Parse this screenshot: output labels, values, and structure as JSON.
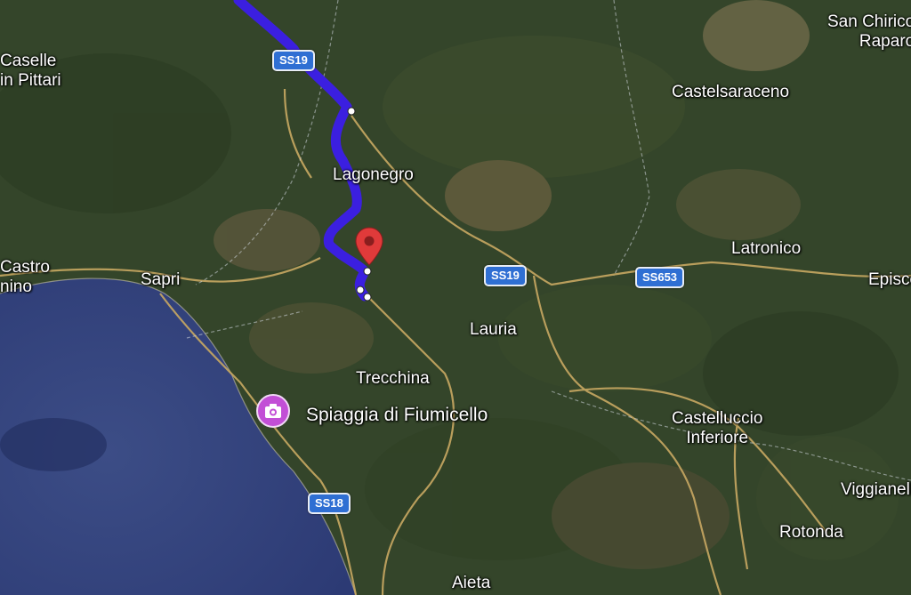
{
  "places": [
    {
      "name": "Caselle\nin Pittari"
    },
    {
      "name": "Lagonegro"
    },
    {
      "name": "Castelsaraceno"
    },
    {
      "name": "San Chirico\nRaparo"
    },
    {
      "name": "Latronico"
    },
    {
      "name": "Episcopia"
    },
    {
      "name": "Sapri"
    },
    {
      "name": "Castro\nnino"
    },
    {
      "name": "Lauria"
    },
    {
      "name": "Trecchina"
    },
    {
      "name": "Castelluccio\nInferiore"
    },
    {
      "name": "Viggianello"
    },
    {
      "name": "Rotonda"
    },
    {
      "name": "Aieta"
    }
  ],
  "roads": [
    "SS19",
    "SS19",
    "SS653",
    "SS18"
  ],
  "poi": {
    "name": "Spiaggia di Fiumicello",
    "icon": "camera-icon",
    "color": "#c24fd6"
  },
  "route": {
    "color": "#3b1fe0"
  },
  "destination": {
    "icon": "map-pin-icon",
    "color": "#e03a3a"
  }
}
